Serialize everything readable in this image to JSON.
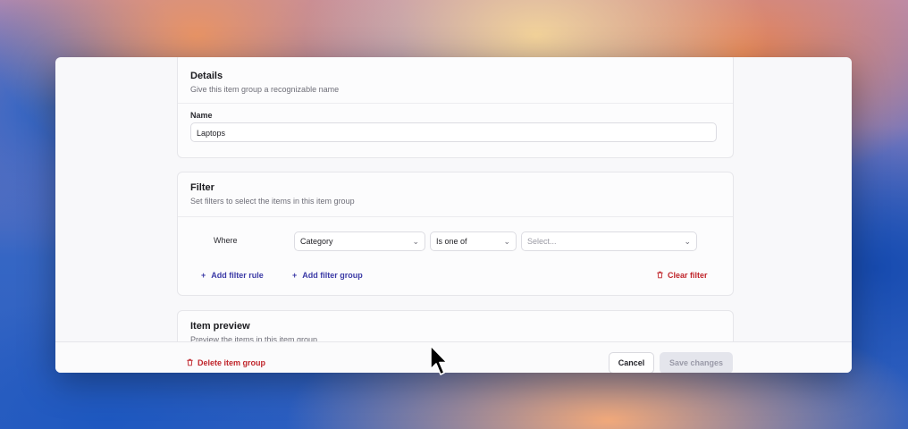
{
  "details": {
    "title": "Details",
    "subtitle": "Give this item group a recognizable name",
    "name_label": "Name",
    "name_value": "Laptops"
  },
  "filter": {
    "title": "Filter",
    "subtitle": "Set filters to select the items in this item group",
    "where_label": "Where",
    "field_select": "Category",
    "operator_select": "Is one of",
    "value_placeholder": "Select...",
    "add_rule": "Add filter rule",
    "add_group": "Add filter group",
    "clear": "Clear filter"
  },
  "preview": {
    "title": "Item preview",
    "subtitle": "Preview the items in this item group"
  },
  "footer": {
    "delete": "Delete item group",
    "cancel": "Cancel",
    "save": "Save changes"
  },
  "icons": {
    "plus": "plus-icon",
    "trash": "trash-icon",
    "chevron": "chevron-down-icon",
    "cursor": "mouse-cursor-icon"
  },
  "colors": {
    "accent": "#3b3aa6",
    "danger": "#c0252b",
    "save_disabled_bg": "#e4e5ec"
  }
}
